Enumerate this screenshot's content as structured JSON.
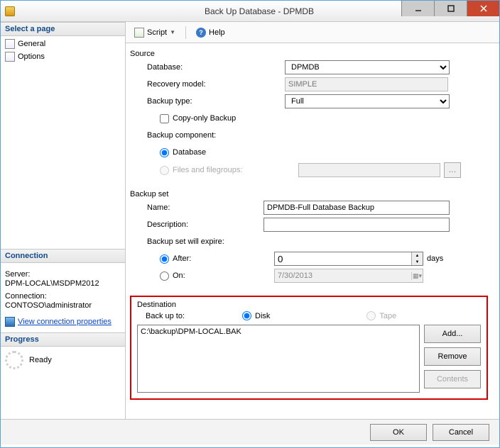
{
  "window": {
    "title": "Back Up Database - DPMDB"
  },
  "left": {
    "select_page_header": "Select a page",
    "pages": [
      {
        "label": "General"
      },
      {
        "label": "Options"
      }
    ],
    "connection_header": "Connection",
    "server_label": "Server:",
    "server_value": "DPM-LOCAL\\MSDPM2012",
    "connection_label": "Connection:",
    "connection_value": "CONTOSO\\administrator",
    "view_props_link": "View connection properties",
    "progress_header": "Progress",
    "progress_status": "Ready"
  },
  "toolbar": {
    "script_label": "Script",
    "help_label": "Help"
  },
  "source": {
    "legend": "Source",
    "database_label": "Database:",
    "database_value": "DPMDB",
    "recovery_label": "Recovery model:",
    "recovery_value": "SIMPLE",
    "backup_type_label": "Backup type:",
    "backup_type_value": "Full",
    "copy_only_label": "Copy-only Backup",
    "component_label": "Backup component:",
    "radio_database": "Database",
    "radio_filegroups": "Files and filegroups:"
  },
  "backup_set": {
    "legend": "Backup set",
    "name_label": "Name:",
    "name_value": "DPMDB-Full Database Backup",
    "description_label": "Description:",
    "description_value": "",
    "expire_label": "Backup set will expire:",
    "after_label": "After:",
    "after_value": "0",
    "days_label": "days",
    "on_label": "On:",
    "on_value": "7/30/2013"
  },
  "destination": {
    "legend": "Destination",
    "backupto_label": "Back up to:",
    "radio_disk": "Disk",
    "radio_tape": "Tape",
    "paths": [
      "C:\\backup\\DPM-LOCAL.BAK"
    ],
    "add_label": "Add...",
    "remove_label": "Remove",
    "contents_label": "Contents"
  },
  "footer": {
    "ok": "OK",
    "cancel": "Cancel"
  }
}
